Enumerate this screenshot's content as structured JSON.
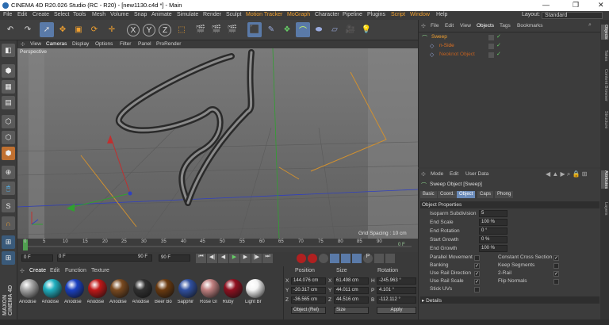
{
  "window": {
    "title": "CINEMA 4D R20.026 Studio (RC - R20) - [new1130.c4d *] - Main",
    "minimize": "—",
    "maximize": "❐",
    "close": "✕"
  },
  "menu": [
    "File",
    "Edit",
    "Create",
    "Select",
    "Tools",
    "Mesh",
    "Volume",
    "Snap",
    "Animate",
    "Simulate",
    "Render",
    "Sculpt",
    "Motion Tracker",
    "MoGraph",
    "Character",
    "Pipeline",
    "Plugins",
    "Script",
    "Window",
    "Help"
  ],
  "layout": {
    "label": "Layout:",
    "value": "Standard"
  },
  "viewport": {
    "menu": [
      "View",
      "Cameras",
      "Display",
      "Options",
      "Filter",
      "Panel",
      "ProRender"
    ],
    "camera": "Perspective",
    "grid_spacing": "Grid Spacing : 10 cm"
  },
  "timeline": {
    "ticks": [
      "0",
      "5",
      "10",
      "15",
      "20",
      "25",
      "30",
      "35",
      "40",
      "45",
      "50",
      "55",
      "60",
      "65",
      "70",
      "75",
      "80",
      "85",
      "90"
    ],
    "current_frame": "0 F",
    "start_frame": "0 F",
    "end_frame": "90 F",
    "max_frame": "90 F"
  },
  "materials": {
    "menu": [
      "Create",
      "Edit",
      "Function",
      "Texture"
    ],
    "items": [
      {
        "label": "Anodise",
        "color": "#a8a8a8"
      },
      {
        "label": "Anodise",
        "color": "#20b0c0"
      },
      {
        "label": "Anodise",
        "color": "#1a40c0"
      },
      {
        "label": "Anodise",
        "color": "#c01818"
      },
      {
        "label": "Anodise",
        "color": "#7a4a20"
      },
      {
        "label": "Anodise",
        "color": "#303030"
      },
      {
        "label": "Beer Bo",
        "color": "#6a3a10"
      },
      {
        "label": "Sapphir",
        "color": "#3050a0"
      },
      {
        "label": "Rose Gl",
        "color": "#c08080"
      },
      {
        "label": "Ruby",
        "color": "#901020"
      },
      {
        "label": "Light Br",
        "color": "#f4f4f4"
      }
    ]
  },
  "coords": {
    "headers": [
      "Position",
      "Size",
      "Rotation"
    ],
    "rows": [
      {
        "axis": "X",
        "pos": "144.076 cm",
        "size_axis": "X",
        "size": "61.498 cm",
        "rot_axis": "H",
        "rot": "-245.963 °"
      },
      {
        "axis": "Y",
        "pos": "-20.317 cm",
        "size_axis": "Y",
        "size": "44.011 cm",
        "rot_axis": "P",
        "rot": "4.101 °"
      },
      {
        "axis": "Z",
        "pos": "-36.565 cm",
        "size_axis": "Z",
        "size": "44.516 cm",
        "rot_axis": "B",
        "rot": "-112.112 °"
      }
    ],
    "mode": "Object (Rel)",
    "size_mode": "Size",
    "apply": "Apply"
  },
  "objects": {
    "menu": [
      "File",
      "Edit",
      "View",
      "Objects",
      "Tags",
      "Bookmarks"
    ],
    "items": [
      {
        "name": "Sweep",
        "color": "#f0a030"
      },
      {
        "name": "n-Side",
        "color": "#e07020"
      },
      {
        "name": "Neoknot Object",
        "color": "#c06020"
      }
    ]
  },
  "attributes": {
    "menu": [
      "Mode",
      "Edit",
      "User Data"
    ],
    "title": "Sweep Object [Sweep]",
    "tabs": [
      "Basic",
      "Coord.",
      "Object",
      "Caps",
      "Phong"
    ],
    "active_tab": "Object",
    "section": "Object Properties",
    "fields": [
      {
        "label": "Isoparm Subdivision",
        "value": "5"
      },
      {
        "label": "End Scale",
        "value": "100 %"
      },
      {
        "label": "End Rotation",
        "value": "0 °"
      },
      {
        "label": "Start Growth",
        "value": "0 %"
      },
      {
        "label": "End Growth",
        "value": "100 %"
      }
    ],
    "checks_left": [
      {
        "label": "Parallel Movement",
        "checked": false
      },
      {
        "label": "Banking",
        "checked": true
      },
      {
        "label": "Use Rail Direction",
        "checked": true
      },
      {
        "label": "Use Rail Scale",
        "checked": true
      },
      {
        "label": "Stick UVs",
        "checked": false
      }
    ],
    "checks_right": [
      {
        "label": "Constant Cross Section",
        "checked": true
      },
      {
        "label": "Keep Segments",
        "checked": false
      },
      {
        "label": "2-Rail",
        "checked": true
      },
      {
        "label": "Flip Normals",
        "checked": false
      }
    ],
    "details": "Details"
  },
  "right_tabs": [
    "Objects",
    "Takes",
    "Content Browser",
    "Structure",
    "Attributes",
    "Layers"
  ],
  "brand": {
    "vertical": "MAXON CINEMA 4D"
  }
}
